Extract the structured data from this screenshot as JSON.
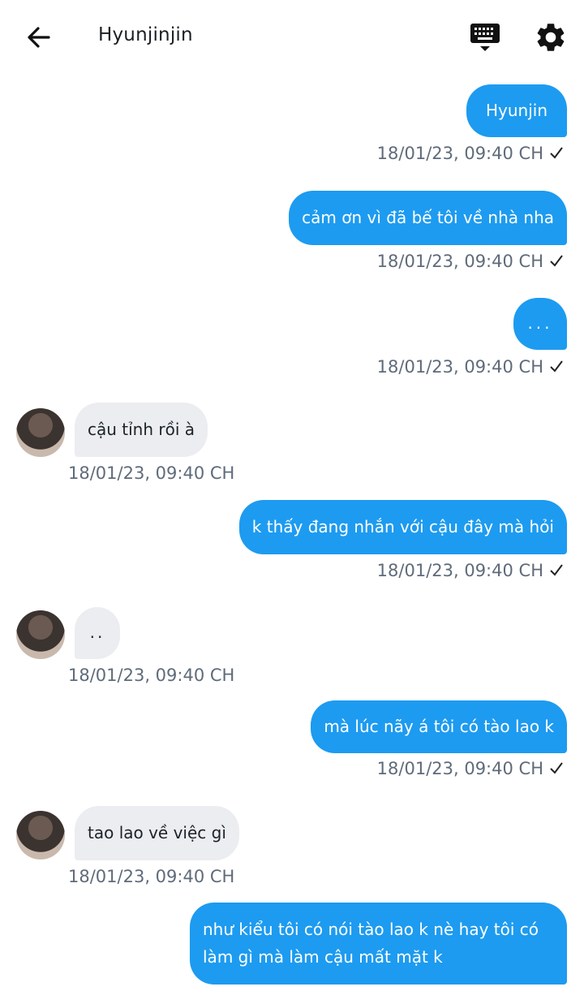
{
  "header": {
    "title": "Hyunjinjin",
    "back_icon": "arrow-left-icon",
    "keyboard_icon": "keyboard-icon",
    "settings_icon": "gear-icon"
  },
  "colors": {
    "sent": "#1d9bf0",
    "received": "#ebedf0",
    "timestamp": "#5f6b7a"
  },
  "messages": [
    {
      "side": "sent",
      "text": "Hyunjin",
      "time": "18/01/23,  09:40 CH",
      "status": "read-check-icon"
    },
    {
      "side": "sent",
      "text": "cảm ơn vì đã bế tôi về nhà nha",
      "time": "18/01/23,  09:40 CH",
      "status": "read-check-icon"
    },
    {
      "side": "sent",
      "text": "...",
      "time": "18/01/23,  09:40 CH",
      "status": "read-check-icon"
    },
    {
      "side": "received",
      "text": "cậu tỉnh rồi à",
      "time": "18/01/23,  09:40 CH"
    },
    {
      "side": "sent",
      "text": "k thấy đang nhắn với cậu đây mà hỏi",
      "time": "18/01/23,  09:40 CH",
      "status": "read-check-icon"
    },
    {
      "side": "received",
      "text": "..",
      "time": "18/01/23,  09:40 CH"
    },
    {
      "side": "sent",
      "text": "mà lúc nãy á tôi có tào lao k",
      "time": "18/01/23,  09:40 CH",
      "status": "read-check-icon"
    },
    {
      "side": "received",
      "text": "tao lao về việc gì",
      "time": "18/01/23,  09:40 CH"
    },
    {
      "side": "sent",
      "text": "như kiểu tôi có nói tào lao k nè hay tôi có làm gì mà làm cậu mất mặt k"
    }
  ]
}
